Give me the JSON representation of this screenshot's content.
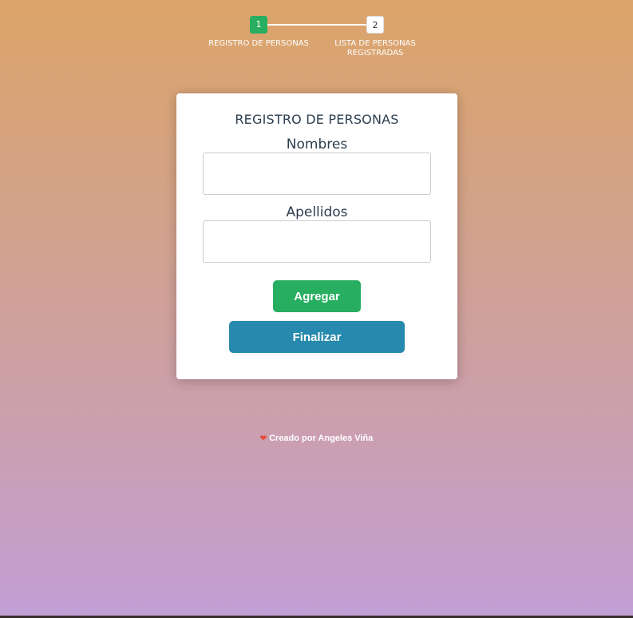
{
  "stepper": {
    "steps": [
      {
        "number": "1",
        "label": "REGISTRO DE PERSONAS"
      },
      {
        "number": "2",
        "label": "LISTA DE PERSONAS REGISTRADAS"
      }
    ],
    "active_step": 1,
    "colors": {
      "active": "#27ae60",
      "inactive": "#ffffff"
    }
  },
  "form": {
    "title": "REGISTRO DE PERSONAS",
    "fields": [
      {
        "label": "Nombres",
        "value": "",
        "placeholder": ""
      },
      {
        "label": "Apellidos",
        "value": "",
        "placeholder": ""
      }
    ],
    "add_button": "Agregar",
    "finish_button": "Finalizar",
    "colors": {
      "add": "#27ae60",
      "finish": "#2889ae"
    }
  },
  "footer": {
    "icon": "heart-icon",
    "text": "Creado por Angeles Viña"
  }
}
